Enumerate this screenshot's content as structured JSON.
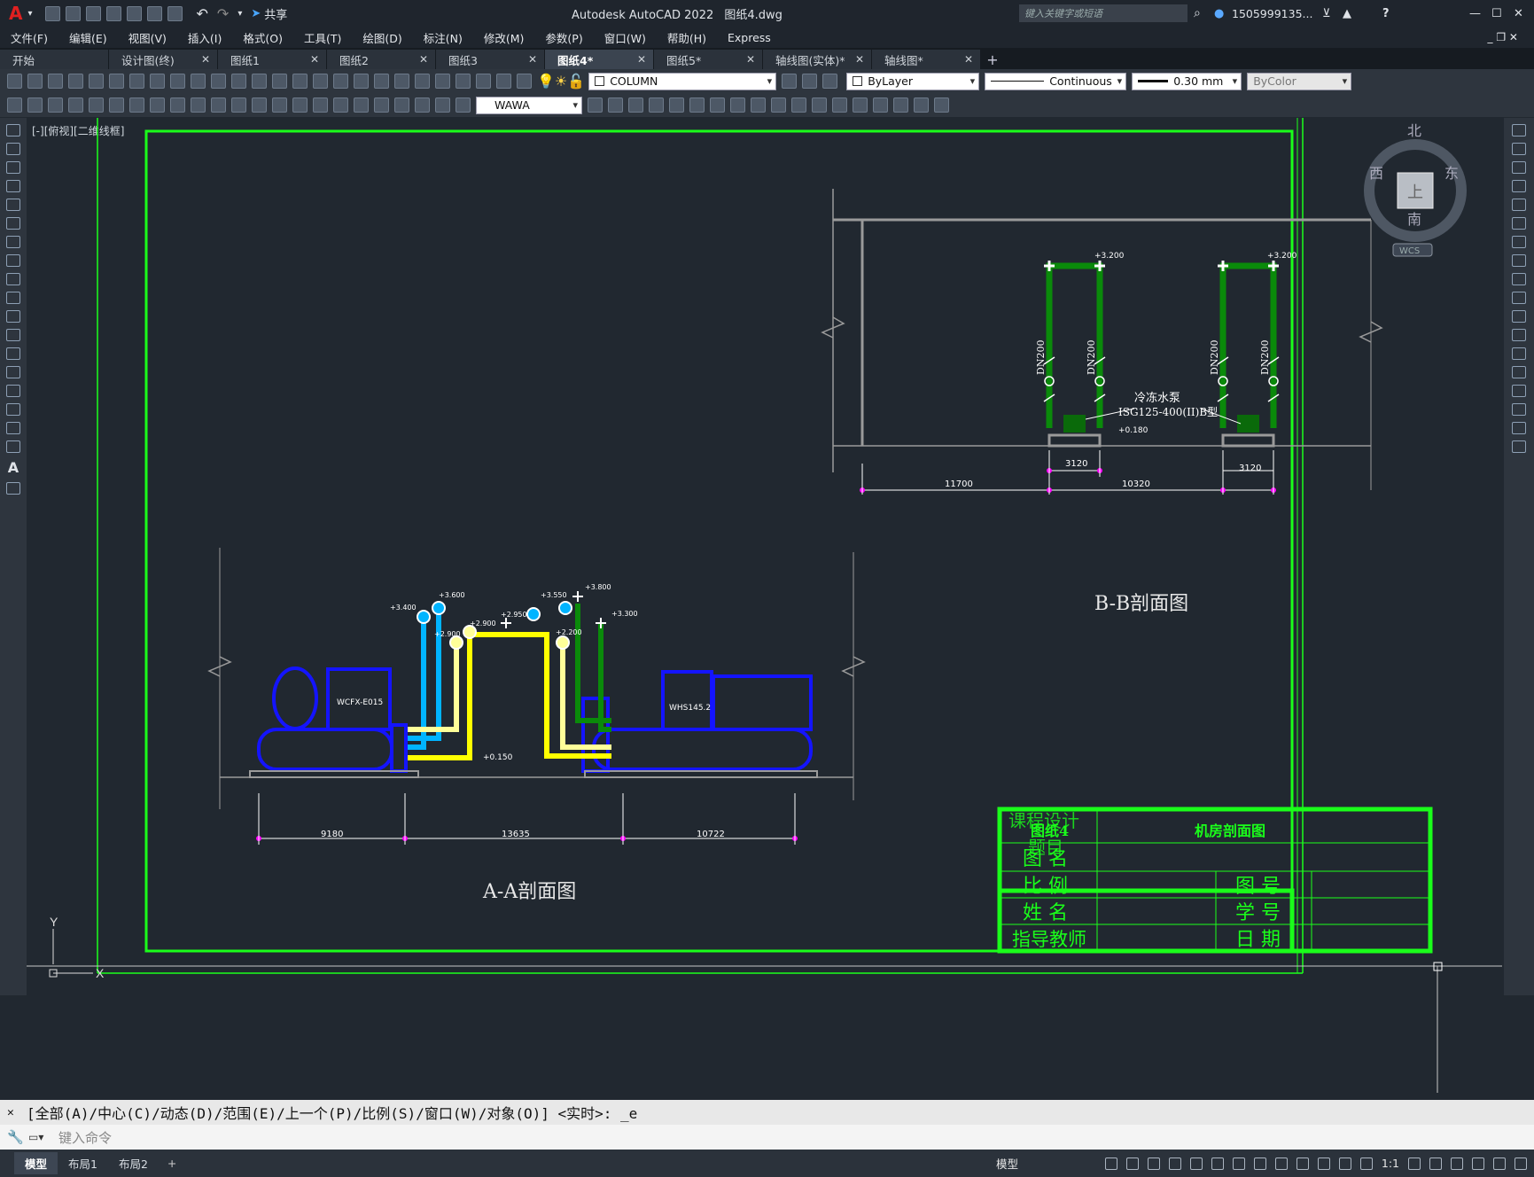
{
  "app": {
    "logo": "A",
    "title": "Autodesk AutoCAD 2022",
    "filename": "图纸4.dwg",
    "share": "共享",
    "search_placeholder": "键入关键字或短语",
    "user": "1505999135...",
    "help": "?"
  },
  "menu": [
    "文件(F)",
    "编辑(E)",
    "视图(V)",
    "插入(I)",
    "格式(O)",
    "工具(T)",
    "绘图(D)",
    "标注(N)",
    "修改(M)",
    "参数(P)",
    "窗口(W)",
    "帮助(H)",
    "Express"
  ],
  "file_tabs": [
    {
      "label": "开始",
      "active": false,
      "closable": false
    },
    {
      "label": "设计图(终)",
      "active": false,
      "closable": true
    },
    {
      "label": "图纸1",
      "active": false,
      "closable": true
    },
    {
      "label": "图纸2",
      "active": false,
      "closable": true
    },
    {
      "label": "图纸3",
      "active": false,
      "closable": true
    },
    {
      "label": "图纸4*",
      "active": true,
      "closable": true
    },
    {
      "label": "图纸5*",
      "active": false,
      "closable": true
    },
    {
      "label": "轴线图(实体)*",
      "active": false,
      "closable": true
    },
    {
      "label": "轴线图*",
      "active": false,
      "closable": true
    }
  ],
  "toolbar": {
    "layer": "COLUMN",
    "color": "ByLayer",
    "linetype": "Continuous",
    "lineweight": "0.30 mm",
    "plotstyle": "ByColor",
    "dimstyle": "WAWA"
  },
  "viewport_label": "[-][俯视][二维线框]",
  "viewcube": {
    "n": "北",
    "s": "南",
    "w": "西",
    "e": "东",
    "top": "上",
    "wcs": "WCS"
  },
  "ucs": {
    "x": "X",
    "y": "Y"
  },
  "drawing": {
    "section_bb": {
      "title": "B-B剖面图",
      "pump_label": "冷冻水泵",
      "pump_model": "ISG125-400(II)B型",
      "pipe": "DN200",
      "elev_top": "+3.200",
      "elev_bottom": "+0.180",
      "dims": [
        "11700",
        "3120",
        "10320",
        "3120"
      ]
    },
    "section_aa": {
      "title": "A-A剖面图",
      "unit1": "WCFX-E015",
      "unit2": "WHS145.2",
      "elev": "+0.150",
      "elevs": [
        "+3.400",
        "+3.600",
        "+2.900",
        "+2.900",
        "+3.550",
        "+2.950",
        "+3.800",
        "+3.300",
        "+2.200"
      ],
      "dims": [
        "9180",
        "13635",
        "10722"
      ]
    },
    "titleblock": {
      "course": "课程设计",
      "subject": "题目",
      "sheet": "图纸4",
      "drawing_title": "机房剖面图",
      "name_label": "图 名",
      "scale_label": "比 例",
      "number_label": "图 号",
      "student_label": "姓 名",
      "id_label": "学 号",
      "teacher_label": "指导教师",
      "date_label": "日 期"
    }
  },
  "command_history": "[全部(A)/中心(C)/动态(D)/范围(E)/上一个(P)/比例(S)/窗口(W)/对象(O)] <实时>: _e",
  "command_placeholder": "键入命令",
  "layout_tabs": [
    {
      "label": "模型",
      "active": true
    },
    {
      "label": "布局1",
      "active": false
    },
    {
      "label": "布局2",
      "active": false
    }
  ],
  "status": {
    "mode": "模型",
    "scale": "1:1"
  },
  "colors": {
    "frame": "#1aff1a",
    "blue": "#0000ff",
    "cyan": "#00b4ff",
    "yellow": "#ffff00",
    "lightyellow": "#ffff99",
    "green": "#0a8a0a",
    "magenta": "#ff00ff",
    "white": "#ffffff",
    "gray": "#9a9a9a",
    "bg": "#212830"
  }
}
